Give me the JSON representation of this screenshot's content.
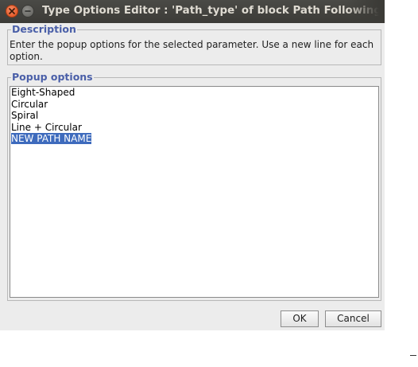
{
  "window": {
    "title": "Type Options Editor : 'Path_type' of block Path Following Co"
  },
  "description": {
    "legend": "Description",
    "text": "Enter the popup options for the selected parameter. Use a new line for each option."
  },
  "popup_options": {
    "legend": "Popup options",
    "items": [
      "Eight-Shaped",
      "Circular",
      "Spiral",
      "Line + Circular",
      "NEW PATH NAME"
    ],
    "selected_item": "NEW PATH NAME"
  },
  "buttons": {
    "ok_label": "OK",
    "cancel_label": "Cancel"
  },
  "colors": {
    "title_bar": "#3c3b37",
    "close_button": "#df4a16",
    "legend_text": "#4a5fa8",
    "selection": "#3e6bbd",
    "dialog_background": "#ececec"
  }
}
